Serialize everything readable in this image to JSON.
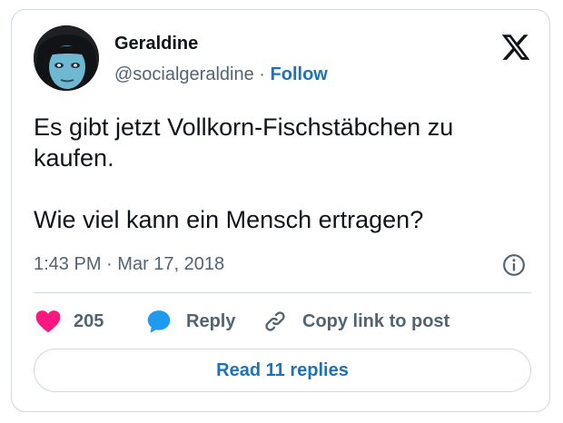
{
  "author": {
    "name": "Geraldine",
    "handle": "@socialgeraldine",
    "separator": "·",
    "follow_label": "Follow",
    "avatar_icon": "profile-photo"
  },
  "brand": {
    "logo_icon": "x-logo-icon"
  },
  "tweet": {
    "paragraphs": [
      "Es gibt jetzt Vollkorn-Fischstäbchen zu kaufen.",
      "Wie viel kann ein Mensch ertragen?"
    ],
    "time": "1:43 PM",
    "dot": "·",
    "date": "Mar 17, 2018",
    "info_icon": "info-icon"
  },
  "actions": {
    "like": {
      "icon": "heart-icon",
      "count": "205"
    },
    "reply": {
      "icon": "speech-bubble-icon",
      "label": "Reply"
    },
    "copy": {
      "icon": "link-icon",
      "label": "Copy link to post"
    }
  },
  "read_replies_label": "Read 11 replies",
  "colors": {
    "text": "#0f1419",
    "secondary": "#536471",
    "link": "#1d72b8",
    "heart": "#f91880",
    "reply_bubble": "#1d9bf0",
    "border": "#cfd9de"
  }
}
